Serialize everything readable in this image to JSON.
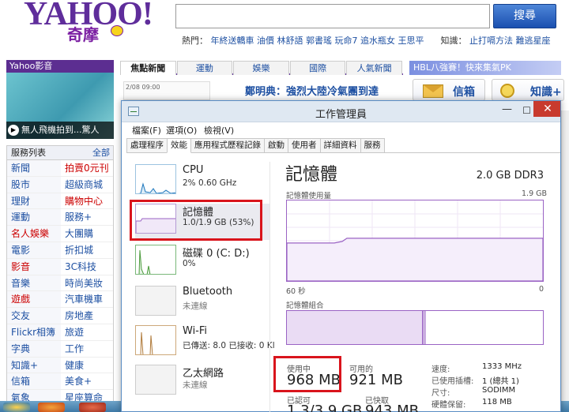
{
  "yahoo": {
    "logo_text": "YAHOO!",
    "logo_sub": "奇摩",
    "search_button": "搜尋",
    "hot_label": "熱門：",
    "hot_links": [
      "年終送轎車",
      "油價",
      "林舒語",
      "郭書瑤",
      "玩命7",
      "追水瓶女",
      "王思平"
    ],
    "knowledge_label": "知識：",
    "knowledge_links": [
      "止打嗝方法",
      "難逃星座"
    ],
    "video_header": "Yahoo影音",
    "video_caption": "無人飛機拍到...驚人",
    "services_title": "服務列表",
    "services_all": "全部",
    "services": [
      {
        "label": "新聞",
        "hot": false
      },
      {
        "label": "拍賣0元刊",
        "hot": true
      },
      {
        "label": "股市",
        "hot": false
      },
      {
        "label": "超級商城",
        "hot": false
      },
      {
        "label": "理財",
        "hot": false
      },
      {
        "label": "購物中心",
        "hot": true
      },
      {
        "label": "運動",
        "hot": false
      },
      {
        "label": "服務+",
        "hot": false
      },
      {
        "label": "名人娛樂",
        "hot": true
      },
      {
        "label": "大團購",
        "hot": false
      },
      {
        "label": "電影",
        "hot": false
      },
      {
        "label": "折扣城",
        "hot": false
      },
      {
        "label": "影音",
        "hot": true
      },
      {
        "label": "3C科技",
        "hot": false
      },
      {
        "label": "音樂",
        "hot": false
      },
      {
        "label": "時尚美妝",
        "hot": false
      },
      {
        "label": "遊戲",
        "hot": true
      },
      {
        "label": "汽車機車",
        "hot": false
      },
      {
        "label": "交友",
        "hot": false
      },
      {
        "label": "房地產",
        "hot": false
      },
      {
        "label": "Flickr相簿",
        "hot": false
      },
      {
        "label": "旅遊",
        "hot": false
      },
      {
        "label": "字典",
        "hot": false
      },
      {
        "label": "工作",
        "hot": false
      },
      {
        "label": "知識+",
        "hot": false
      },
      {
        "label": "健康",
        "hot": false
      },
      {
        "label": "信箱",
        "hot": false
      },
      {
        "label": "美食+",
        "hot": false
      },
      {
        "label": "氣象",
        "hot": false
      },
      {
        "label": "星座算命",
        "hot": false
      }
    ],
    "news_tabs": [
      "焦點新聞",
      "運動",
      "娛樂",
      "國際",
      "人氣新聞"
    ],
    "news_thumb_text": "2/08 09:00",
    "news_headline": "鄭明典：強烈大陸冷氣團到達",
    "hbl_text": "HBL八強賽！快來集氣PK",
    "mail_label": "信箱",
    "knowledge_button": "知識+"
  },
  "taskmanager": {
    "title": "工作管理員",
    "menu": [
      "檔案(F)",
      "選項(O)",
      "檢視(V)"
    ],
    "tabs": [
      "處理程序",
      "效能",
      "應用程式歷程記錄",
      "啟動",
      "使用者",
      "詳細資料",
      "服務"
    ],
    "active_tab": "效能",
    "resources": {
      "cpu": {
        "name": "CPU",
        "detail": "2% 0.60 GHz"
      },
      "memory": {
        "name": "記憶體",
        "detail": "1.0/1.9 GB (53%)"
      },
      "disk": {
        "name": "磁碟 0 (C: D:)",
        "detail": "0%"
      },
      "bluetooth": {
        "name": "Bluetooth",
        "detail": "未連線"
      },
      "wifi": {
        "name": "Wi-Fi",
        "detail": "已傳送: 8.0 已接收: 0 Kl"
      },
      "ethernet": {
        "name": "乙太網路",
        "detail": "未連線"
      }
    },
    "detail": {
      "title": "記憶體",
      "spec": "2.0 GB DDR3",
      "usage_label": "記憶體使用量",
      "usage_max": "1.9 GB",
      "axis_left": "60 秒",
      "axis_right": "0",
      "composition_label": "記憶體組合",
      "usage_level": 0.53,
      "in_use_label": "使用中",
      "in_use_value": "968 MB",
      "available_label": "可用的",
      "available_value": "921 MB",
      "committed_label": "已認可",
      "committed_value": "1.3/3.9 GB",
      "cached_label": "已快取",
      "cached_value": "943 MB",
      "specs": [
        {
          "k": "速度:",
          "v": "1333 MHz"
        },
        {
          "k": "已使用插槽:",
          "v": "1 (總共 1)"
        },
        {
          "k": "尺寸:",
          "v": "SODIMM"
        },
        {
          "k": "硬體保留:",
          "v": "118 MB"
        }
      ]
    },
    "colors": {
      "memory": "#9a63c4",
      "highlight": "#d9141c",
      "close": "#c83a2e"
    }
  }
}
